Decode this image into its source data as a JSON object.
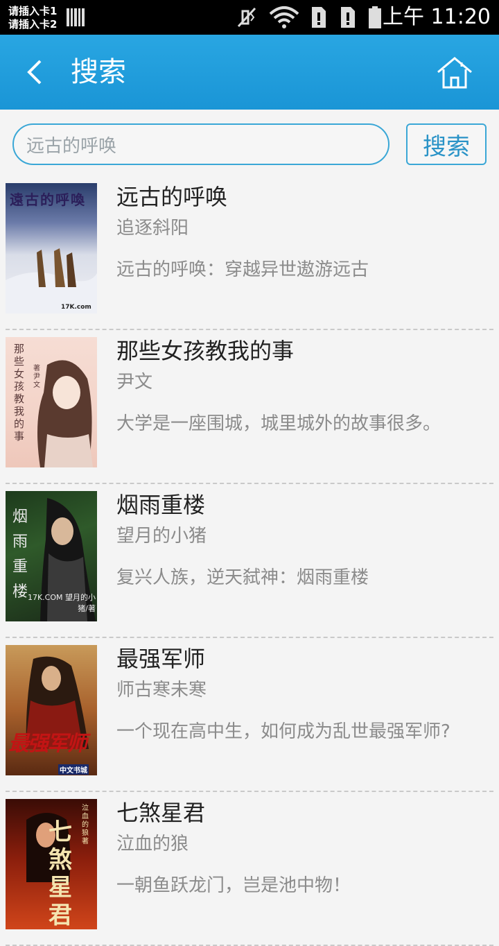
{
  "status_bar": {
    "sim1": "请插入卡1",
    "sim2": "请插入卡2",
    "time": "上午 11:20",
    "icons": [
      "signal-bars-icon",
      "mute-vibrate-icon",
      "wifi-icon",
      "sim1-error-icon",
      "sim2-error-icon",
      "battery-icon"
    ]
  },
  "app_bar": {
    "title": "搜索",
    "back_icon": "back-chevron-icon",
    "home_icon": "home-icon",
    "background": "#1f9ddb"
  },
  "search": {
    "value": "远古的呼唤",
    "button_label": "搜索",
    "accent": "#3aa7d6"
  },
  "results": [
    {
      "title": "远古的呼唤",
      "author": "追逐斜阳",
      "desc": "远古的呼唤：穿越异世遨游远古",
      "cover": {
        "title_text": "遠古的呼喚",
        "credit": "17K.com"
      }
    },
    {
      "title": "那些女孩教我的事",
      "author": "尹文",
      "desc": "大学是一座围城，城里城外的故事很多。",
      "cover": {
        "title_text": "那些女孩教我的事",
        "credit": "著 尹文"
      }
    },
    {
      "title": "烟雨重楼",
      "author": "望月的小猪",
      "desc": "复兴人族，逆天弑神：烟雨重楼",
      "cover": {
        "title_text": "烟雨重楼",
        "credit": "17K.COM 望月的小猪/著"
      }
    },
    {
      "title": "最强军师",
      "author": "师古寒未寒",
      "desc": "一个现在高中生，如何成为乱世最强军师?",
      "cover": {
        "title_text": "最强军师",
        "credit": "中文书城"
      }
    },
    {
      "title": "七煞星君",
      "author": "泣血的狼",
      "desc": "一朝鱼跃龙门，岂是池中物！",
      "cover": {
        "title_text": "七煞星君",
        "credit": "泣血的狼 著"
      }
    }
  ]
}
